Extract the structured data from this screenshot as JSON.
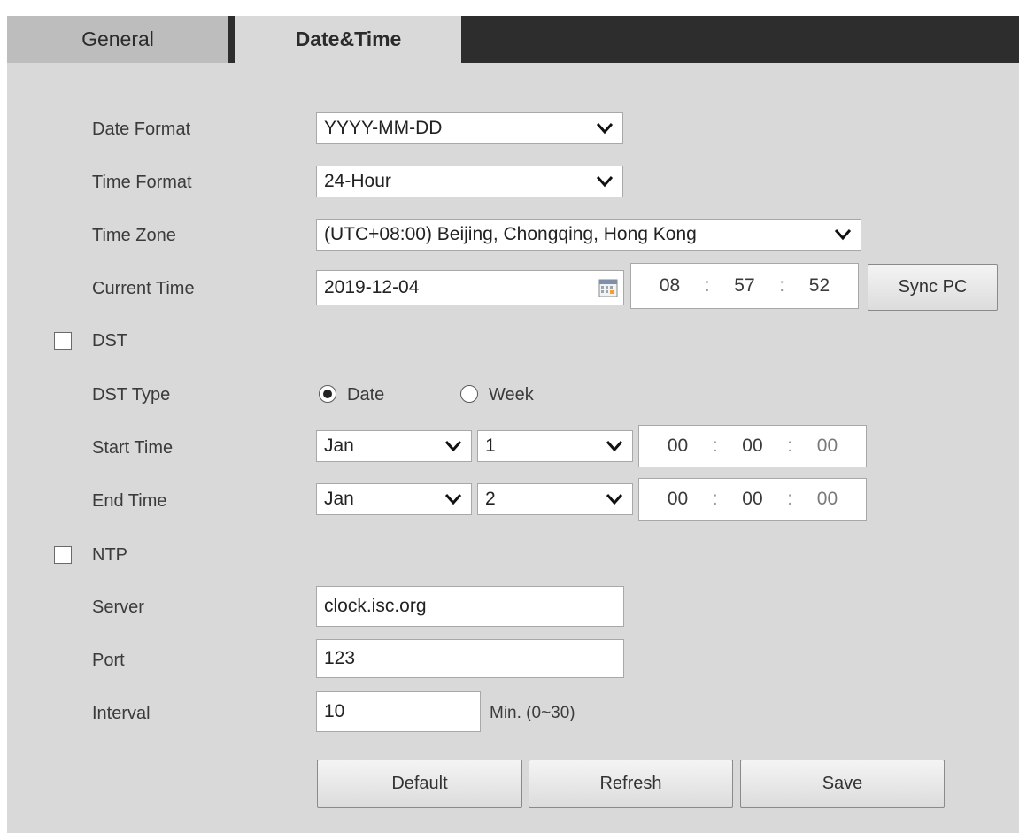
{
  "tabs": {
    "general": "General",
    "datetime": "Date&Time"
  },
  "labels": {
    "date_format": "Date Format",
    "time_format": "Time Format",
    "time_zone": "Time Zone",
    "current_time": "Current Time",
    "dst": "DST",
    "dst_type": "DST Type",
    "start_time": "Start Time",
    "end_time": "End Time",
    "ntp": "NTP",
    "server": "Server",
    "port": "Port",
    "interval": "Interval"
  },
  "fields": {
    "date_format": "YYYY-MM-DD",
    "time_format": "24-Hour",
    "time_zone": "(UTC+08:00) Beijing, Chongqing, Hong Kong",
    "current_date": "2019-12-04",
    "current_time": {
      "h": "08",
      "m": "57",
      "s": "52"
    },
    "start_month": "Jan",
    "start_day": "1",
    "start_time": {
      "h": "00",
      "m": "00",
      "s": "00"
    },
    "end_month": "Jan",
    "end_day": "2",
    "end_time": {
      "h": "00",
      "m": "00",
      "s": "00"
    },
    "server": "clock.isc.org",
    "port": "123",
    "interval": "10",
    "interval_hint": "Min. (0~30)"
  },
  "dst_type": {
    "date": "Date",
    "week": "Week",
    "selected": "Date"
  },
  "checkboxes": {
    "dst": false,
    "ntp": false
  },
  "buttons": {
    "sync_pc": "Sync PC",
    "default": "Default",
    "refresh": "Refresh",
    "save": "Save"
  },
  "separator": ":"
}
